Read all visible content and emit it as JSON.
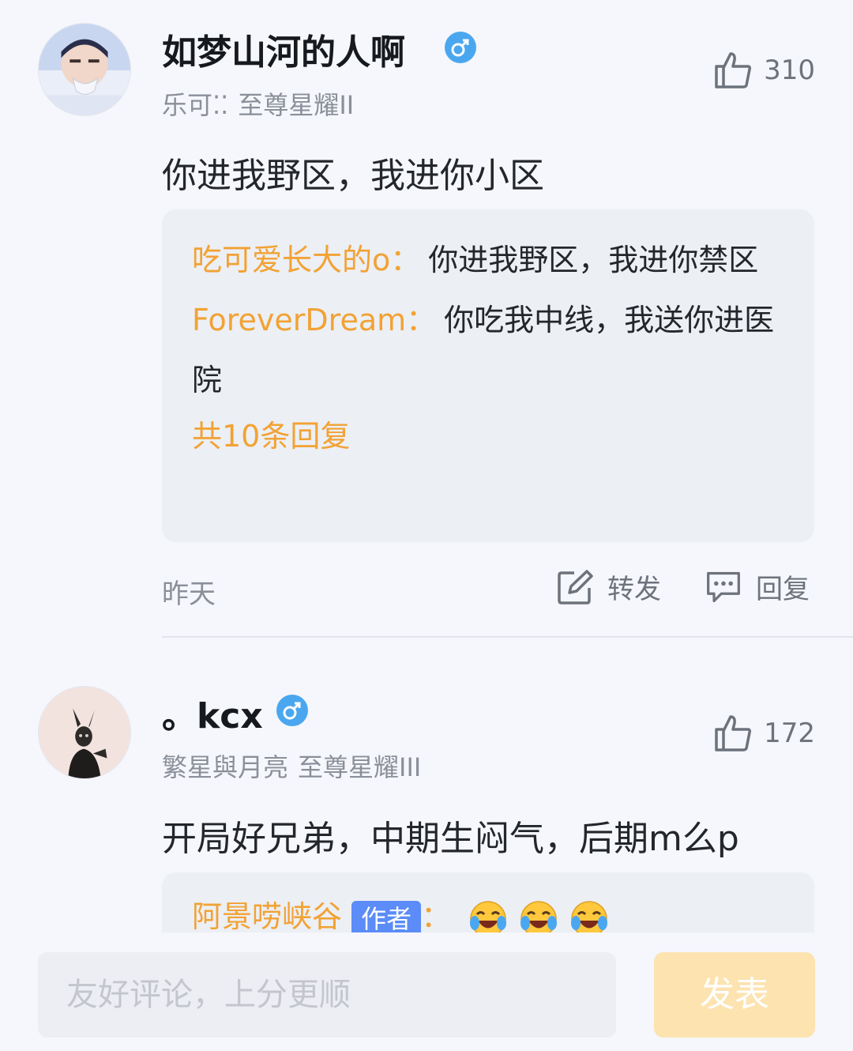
{
  "colors": {
    "accent_orange": "#f2a234",
    "gender_blue": "#4aa7ef",
    "author_badge": "#5b8cf7",
    "send_button_bg": "#fce3b0"
  },
  "comments": [
    {
      "username": "如梦山河的人啊",
      "gender_icon": "male-icon",
      "nickname": "乐可⁚⁚",
      "rank": "至尊星耀II",
      "likes": "310",
      "text": "你进我野区，我进你小区",
      "replies": [
        {
          "user": "吃可爱长大的o",
          "sep": "：",
          "text": "你进我野区，我进你禁区"
        },
        {
          "user": "ForeverDream",
          "sep": "：",
          "text": "你吃我中线，我送你进医院"
        }
      ],
      "more_replies": "共10条回复",
      "time": "昨天",
      "forward_label": "转发",
      "reply_label": "回复"
    },
    {
      "username": "。kcx",
      "gender_icon": "male-icon",
      "nickname": "繁星與月亮",
      "rank": "至尊星耀III",
      "likes": "172",
      "text": "开局好兄弟，中期生闷气，后期m么p",
      "replies": [
        {
          "user": "阿景唠峡谷",
          "badge": "作者",
          "sep": "：",
          "emoji": [
            "laughing-tears-emoji",
            "laughing-tears-emoji",
            "laughing-tears-emoji"
          ]
        }
      ]
    }
  ],
  "composer": {
    "placeholder": "友好评论，上分更顺",
    "send_label": "发表"
  }
}
